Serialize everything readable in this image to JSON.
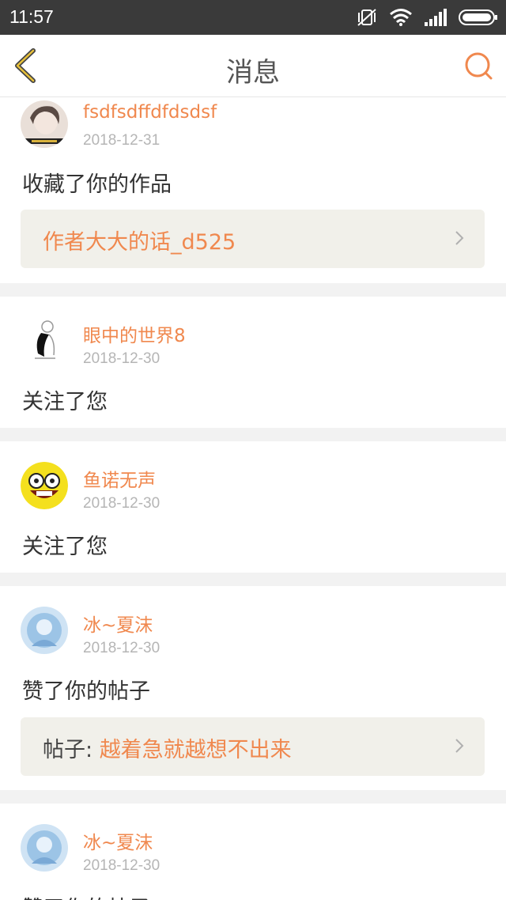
{
  "status": {
    "time": "11:57"
  },
  "header": {
    "title": "消息"
  },
  "colors": {
    "accent": "#f0884e",
    "status_bar": "#3a3a3a",
    "card_bg": "#ffffff",
    "link_box_bg": "#f1f0ea"
  },
  "messages": [
    {
      "user": "fsdfsdffdfdsdsf",
      "date": "2018-12-31",
      "action": "收藏了你的作品",
      "link": {
        "prefix": "",
        "text": "作者大大的话_d525"
      }
    },
    {
      "user": "眼中的世界8",
      "date": "2018-12-30",
      "action": "关注了您"
    },
    {
      "user": "鱼诺无声",
      "date": "2018-12-30",
      "action": "关注了您"
    },
    {
      "user": "冰~夏沫",
      "date": "2018-12-30",
      "action": "赞了你的帖子",
      "link": {
        "prefix": "帖子: ",
        "text": "越着急就越想不出来"
      }
    },
    {
      "user": "冰~夏沫",
      "date": "2018-12-30",
      "action": "赞了你的帖子"
    }
  ]
}
